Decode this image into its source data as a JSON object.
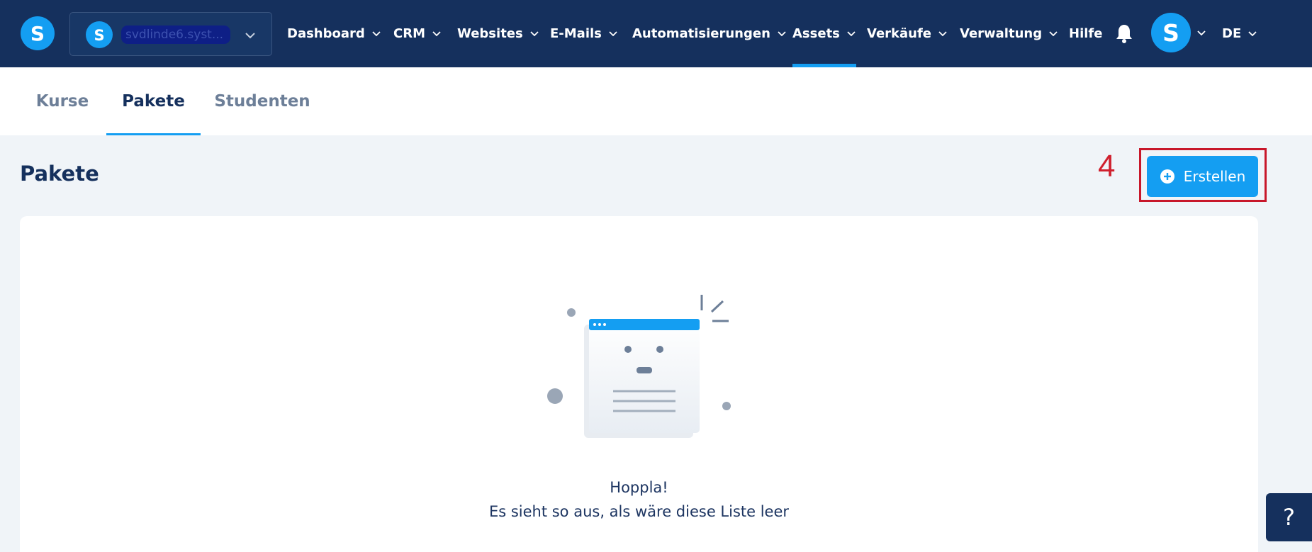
{
  "brand": {
    "logo_letter": "S"
  },
  "project": {
    "logo_letter": "S",
    "name": "svdlinde6.syst..."
  },
  "nav": {
    "items": [
      {
        "label": "Dashboard",
        "has_chevron": true
      },
      {
        "label": "CRM",
        "has_chevron": true
      },
      {
        "label": "Websites",
        "has_chevron": true
      },
      {
        "label": "E-Mails",
        "has_chevron": true
      },
      {
        "label": "Automatisierungen",
        "has_chevron": true
      },
      {
        "label": "Assets",
        "has_chevron": true,
        "active": true
      },
      {
        "label": "Verkäufe",
        "has_chevron": true
      },
      {
        "label": "Verwaltung",
        "has_chevron": true
      },
      {
        "label": "Hilfe",
        "has_chevron": false
      }
    ],
    "notification_icon": "bell-icon",
    "avatar_letter": "S",
    "language": "DE"
  },
  "tabs": [
    {
      "label": "Kurse"
    },
    {
      "label": "Pakete",
      "active": true
    },
    {
      "label": "Studenten"
    }
  ],
  "header": {
    "title": "Pakete",
    "step_marker": "4",
    "create_button": "Erstellen",
    "create_icon": "plus-circle-icon"
  },
  "empty_state": {
    "title": "Hoppla!",
    "message": "Es sieht so aus, als wäre diese Liste leer"
  },
  "help": {
    "label": "?"
  },
  "colors": {
    "navbar_bg": "#15305d",
    "accent": "#149ef2",
    "page_bg": "#f0f4f8",
    "highlight": "#c8172a"
  }
}
